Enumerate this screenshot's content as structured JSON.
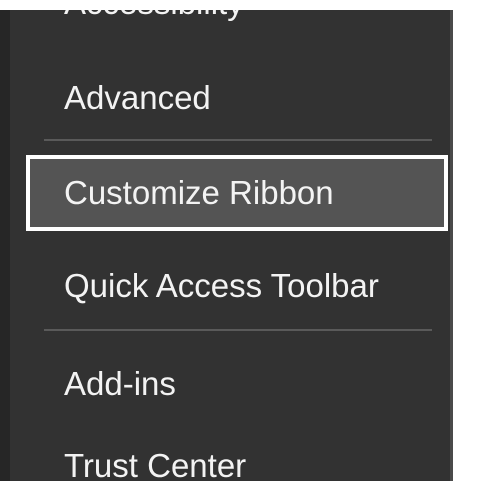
{
  "nav": {
    "items": [
      {
        "label": "Accessibility"
      },
      {
        "label": "Advanced"
      },
      {
        "label": "Customize Ribbon"
      },
      {
        "label": "Quick Access Toolbar"
      },
      {
        "label": "Add-ins"
      },
      {
        "label": "Trust Center"
      }
    ],
    "selected": "Customize Ribbon"
  },
  "colors": {
    "panel_bg": "#323232",
    "selected_bg": "#545454",
    "selected_border": "#ffffff",
    "text": "#f3f3f3",
    "divider": "#5a5a5a"
  }
}
